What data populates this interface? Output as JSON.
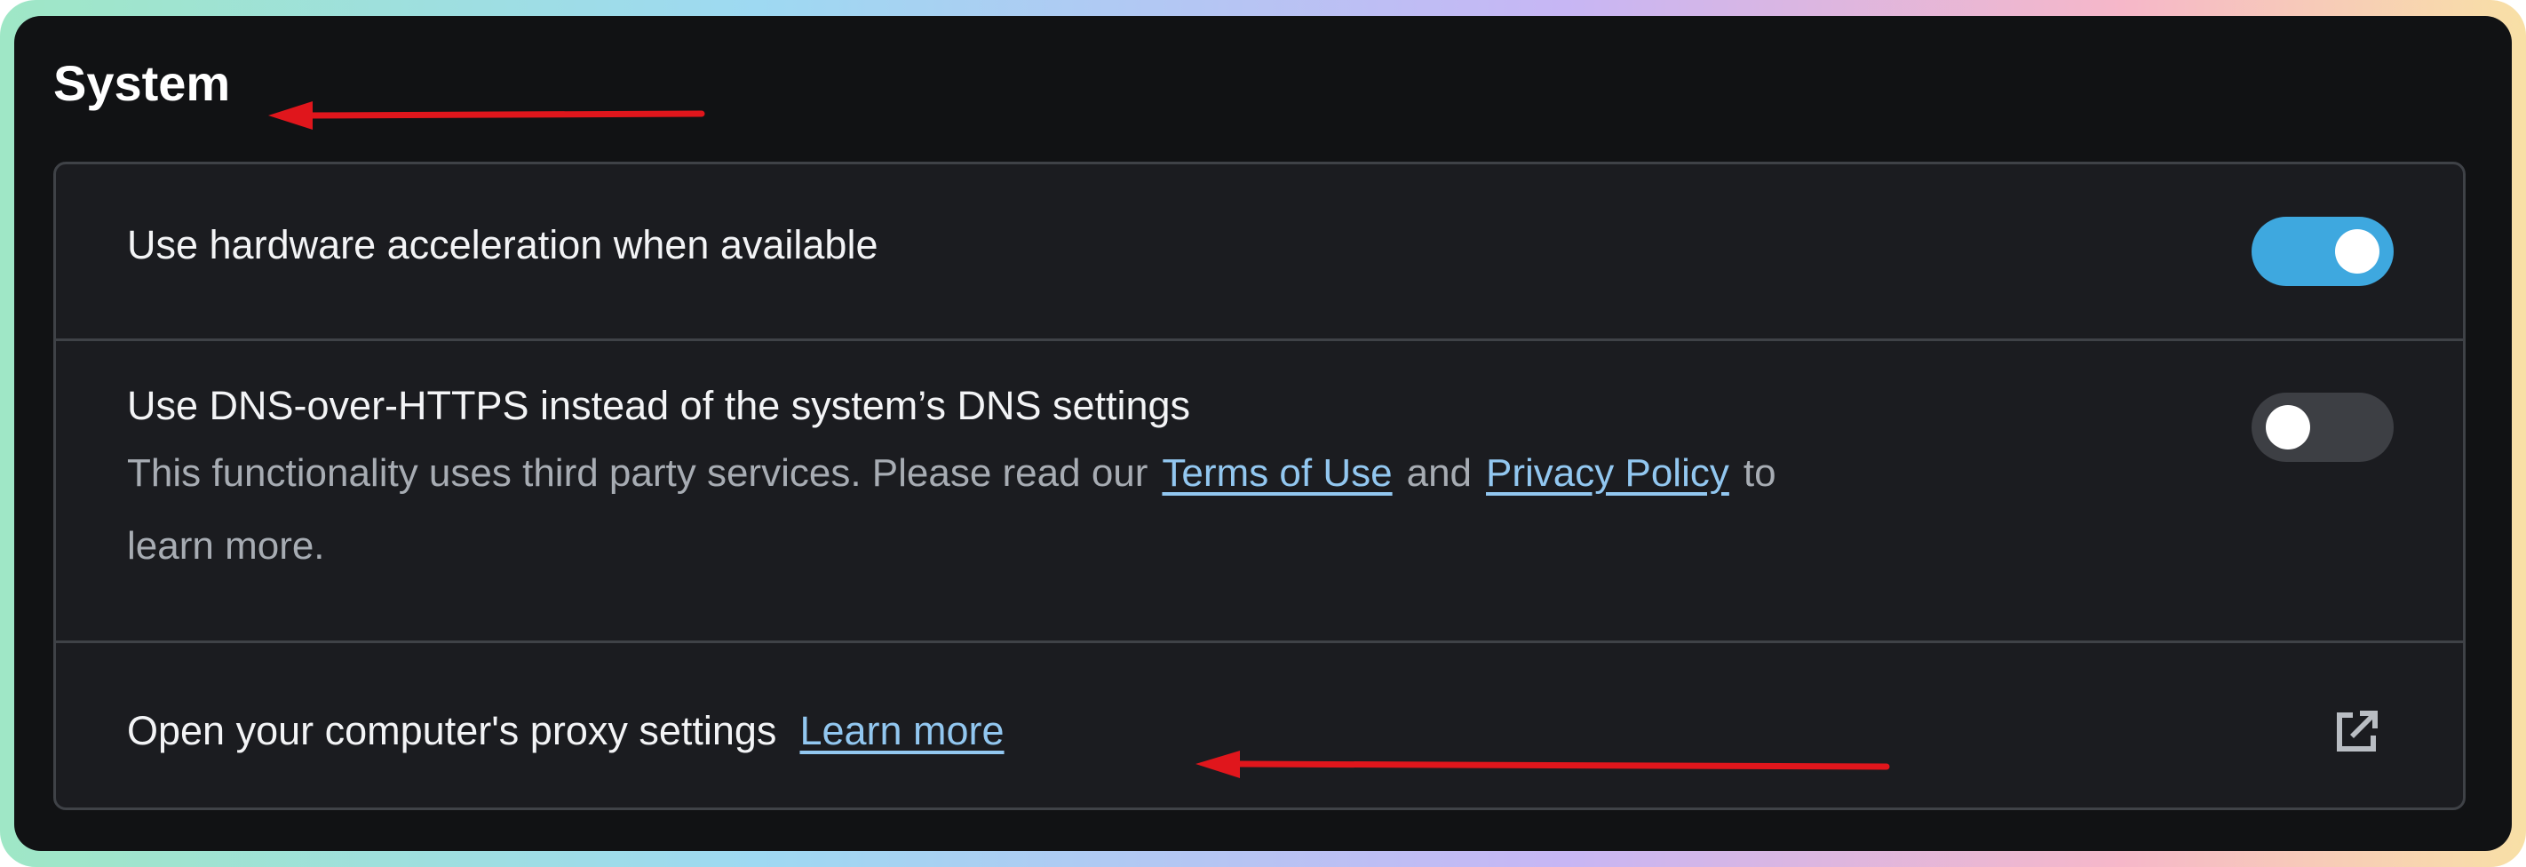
{
  "section": {
    "title": "System"
  },
  "settings": [
    {
      "label": "Use hardware acceleration when available",
      "enabled": true
    },
    {
      "label": "Use DNS-over-HTTPS instead of the system’s DNS settings",
      "enabled": false,
      "description": {
        "text_before": "This functionality uses third party services. Please read our",
        "link_terms": "Terms of Use",
        "text_and": "and",
        "link_privacy": "Privacy Policy",
        "text_to": "to",
        "text_after": "learn more."
      }
    },
    {
      "label": "Open your computer's proxy settings",
      "link": "Learn more",
      "icon": "external-link-icon"
    }
  ],
  "colors": {
    "background": "#111214",
    "card": "#1b1c20",
    "toggle_on": "#3ea8df",
    "toggle_off": "#3d3f44",
    "link": "#92c7f0",
    "annotation_arrow": "#e0161c"
  }
}
